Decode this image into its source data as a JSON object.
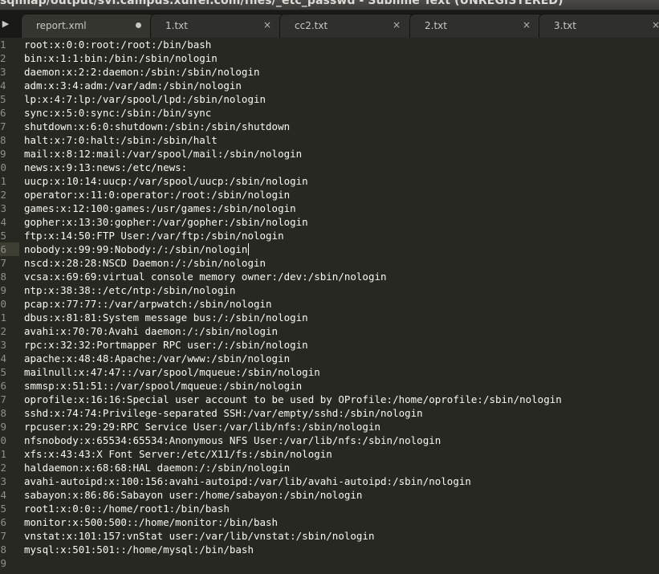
{
  "window": {
    "title": "sqlmap/output/svi.campus.xulfel.com/files/_etc_passwd - Sublime Text (UNREGISTERED)"
  },
  "tabbar": {
    "scroll_left_icon": "triangle-right-icon",
    "tabs": [
      {
        "label": "report.xml",
        "close": "",
        "dirty": true
      },
      {
        "label": "1.txt",
        "close": "×",
        "dirty": false
      },
      {
        "label": "cc2.txt",
        "close": "×",
        "dirty": false
      },
      {
        "label": "2.txt",
        "close": "×",
        "dirty": false
      },
      {
        "label": "3.txt",
        "close": "×",
        "dirty": false
      }
    ]
  },
  "editor": {
    "current_line_index": 15,
    "lines": [
      {
        "num": "1",
        "text": "root:x:0:0:root:/root:/bin/bash"
      },
      {
        "num": "2",
        "text": "bin:x:1:1:bin:/bin:/sbin/nologin"
      },
      {
        "num": "3",
        "text": "daemon:x:2:2:daemon:/sbin:/sbin/nologin"
      },
      {
        "num": "4",
        "text": "adm:x:3:4:adm:/var/adm:/sbin/nologin"
      },
      {
        "num": "5",
        "text": "lp:x:4:7:lp:/var/spool/lpd:/sbin/nologin"
      },
      {
        "num": "6",
        "text": "sync:x:5:0:sync:/sbin:/bin/sync"
      },
      {
        "num": "7",
        "text": "shutdown:x:6:0:shutdown:/sbin:/sbin/shutdown"
      },
      {
        "num": "8",
        "text": "halt:x:7:0:halt:/sbin:/sbin/halt"
      },
      {
        "num": "9",
        "text": "mail:x:8:12:mail:/var/spool/mail:/sbin/nologin"
      },
      {
        "num": "10",
        "text": "news:x:9:13:news:/etc/news:"
      },
      {
        "num": "11",
        "text": "uucp:x:10:14:uucp:/var/spool/uucp:/sbin/nologin"
      },
      {
        "num": "12",
        "text": "operator:x:11:0:operator:/root:/sbin/nologin"
      },
      {
        "num": "13",
        "text": "games:x:12:100:games:/usr/games:/sbin/nologin"
      },
      {
        "num": "14",
        "text": "gopher:x:13:30:gopher:/var/gopher:/sbin/nologin"
      },
      {
        "num": "15",
        "text": "ftp:x:14:50:FTP User:/var/ftp:/sbin/nologin"
      },
      {
        "num": "16",
        "text": "nobody:x:99:99:Nobody:/:/sbin/nologin"
      },
      {
        "num": "17",
        "text": "nscd:x:28:28:NSCD Daemon:/:/sbin/nologin"
      },
      {
        "num": "18",
        "text": "vcsa:x:69:69:virtual console memory owner:/dev:/sbin/nologin"
      },
      {
        "num": "19",
        "text": "ntp:x:38:38::/etc/ntp:/sbin/nologin"
      },
      {
        "num": "20",
        "text": "pcap:x:77:77::/var/arpwatch:/sbin/nologin"
      },
      {
        "num": "21",
        "text": "dbus:x:81:81:System message bus:/:/sbin/nologin"
      },
      {
        "num": "22",
        "text": "avahi:x:70:70:Avahi daemon:/:/sbin/nologin"
      },
      {
        "num": "23",
        "text": "rpc:x:32:32:Portmapper RPC user:/:/sbin/nologin"
      },
      {
        "num": "24",
        "text": "apache:x:48:48:Apache:/var/www:/sbin/nologin"
      },
      {
        "num": "25",
        "text": "mailnull:x:47:47::/var/spool/mqueue:/sbin/nologin"
      },
      {
        "num": "26",
        "text": "smmsp:x:51:51::/var/spool/mqueue:/sbin/nologin"
      },
      {
        "num": "27",
        "text": "oprofile:x:16:16:Special user account to be used by OProfile:/home/oprofile:/sbin/nologin"
      },
      {
        "num": "28",
        "text": "sshd:x:74:74:Privilege-separated SSH:/var/empty/sshd:/sbin/nologin"
      },
      {
        "num": "29",
        "text": "rpcuser:x:29:29:RPC Service User:/var/lib/nfs:/sbin/nologin"
      },
      {
        "num": "30",
        "text": "nfsnobody:x:65534:65534:Anonymous NFS User:/var/lib/nfs:/sbin/nologin"
      },
      {
        "num": "31",
        "text": "xfs:x:43:43:X Font Server:/etc/X11/fs:/sbin/nologin"
      },
      {
        "num": "32",
        "text": "haldaemon:x:68:68:HAL daemon:/:/sbin/nologin"
      },
      {
        "num": "33",
        "text": "avahi-autoipd:x:100:156:avahi-autoipd:/var/lib/avahi-autoipd:/sbin/nologin"
      },
      {
        "num": "34",
        "text": "sabayon:x:86:86:Sabayon user:/home/sabayon:/sbin/nologin"
      },
      {
        "num": "35",
        "text": "root1:x:0:0::/home/root1:/bin/bash"
      },
      {
        "num": "36",
        "text": "monitor:x:500:500::/home/monitor:/bin/bash"
      },
      {
        "num": "37",
        "text": "vnstat:x:101:157:vnStat user:/var/lib/vnstat:/sbin/nologin"
      },
      {
        "num": "38",
        "text": "mysql:x:501:501::/home/mysql:/bin/bash"
      },
      {
        "num": "39",
        "text": ""
      }
    ]
  },
  "colors": {
    "editor_background": "#272822",
    "text": "#f8f8f2",
    "line_number": "#8f908a",
    "current_line_gutter": "#3e3d32",
    "tab_background": "#2f302b",
    "tabbar_background": "#191a17"
  }
}
